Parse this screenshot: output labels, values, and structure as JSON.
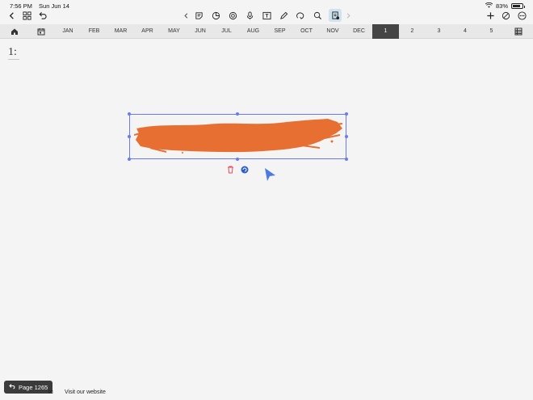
{
  "status": {
    "time": "7:56 PM",
    "date": "Sun Jun 14",
    "battery": "83%"
  },
  "toolbar": {
    "left_icons": [
      "back-chevron-icon",
      "grid-icon",
      "undo-icon"
    ],
    "center_icons": [
      "prev-page-icon",
      "sticky-note-icon",
      "shape-icon",
      "lasso-icon",
      "mic-icon",
      "text-box-icon",
      "pen-icon",
      "lasso-selection-icon",
      "search-icon",
      "template-icon",
      "next-page-icon"
    ],
    "right_icons": [
      "add-icon",
      "eraser-off-icon",
      "more-icon"
    ]
  },
  "nav": {
    "months": [
      "JAN",
      "FEB",
      "MAR",
      "APR",
      "MAY",
      "JUN",
      "JUL",
      "AUG",
      "SEP",
      "OCT",
      "NOV",
      "DEC"
    ],
    "pages": [
      "1",
      "2",
      "3",
      "4",
      "5"
    ],
    "active_page": "1"
  },
  "canvas": {
    "page_number": "1:",
    "stroke_color": "#e76f32",
    "selection_color": "#6a7bf0"
  },
  "footer": {
    "page_badge": "Page 1265",
    "link_text": "Visit our website",
    "partial_text": "ic"
  },
  "colors": {
    "accent": "#6a7bf0",
    "delete": "#e4495e",
    "cursor": "#4d79e0"
  }
}
